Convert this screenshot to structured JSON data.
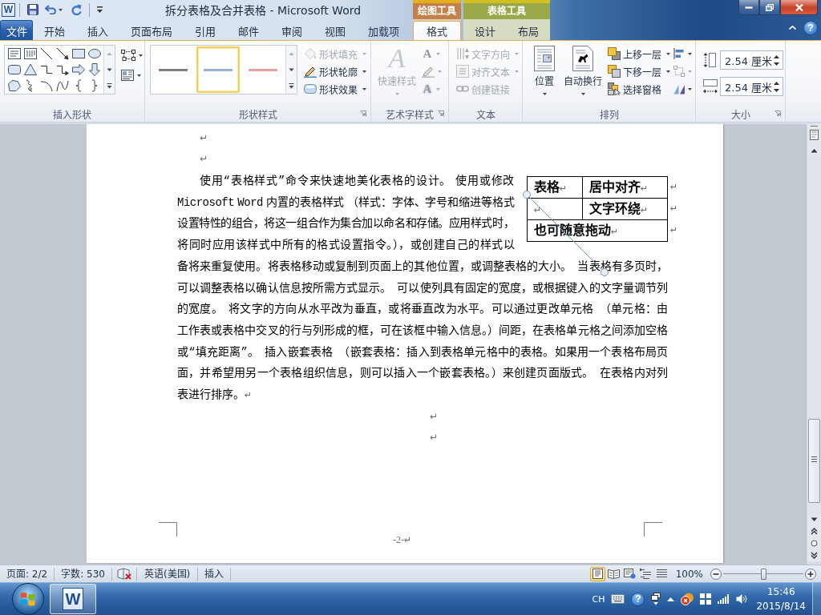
{
  "title_bar": {
    "app_letter": "W",
    "title": "拆分表格及合并表格 - Microsoft Word"
  },
  "file_tab": {
    "label": "文件"
  },
  "tabs": [
    {
      "label": "开始",
      "selected": false
    },
    {
      "label": "插入",
      "selected": false
    },
    {
      "label": "页面布局",
      "selected": false
    },
    {
      "label": "引用",
      "selected": false
    },
    {
      "label": "邮件",
      "selected": false
    },
    {
      "label": "审阅",
      "selected": false
    },
    {
      "label": "视图",
      "selected": false
    },
    {
      "label": "加载项",
      "selected": false
    }
  ],
  "context_groups": [
    {
      "label": "绘图工具",
      "color": "#c4824a",
      "tabs": [
        {
          "label": "格式",
          "selected": true
        }
      ]
    },
    {
      "label": "表格工具",
      "color": "#9aa84a",
      "tabs": [
        {
          "label": "设计",
          "selected": false
        },
        {
          "label": "布局",
          "selected": false
        }
      ]
    }
  ],
  "help": "?",
  "ribbon": {
    "groups": [
      {
        "kind": "shapes",
        "label": "插入形状",
        "launcher": false
      },
      {
        "kind": "shape_styles",
        "label": "形状样式",
        "launcher": true,
        "styles": [
          {
            "color": "#7f7f7f",
            "selected": false
          },
          {
            "color": "#95b3d7",
            "selected": true
          },
          {
            "color": "#e6a0a0",
            "selected": false
          }
        ],
        "commands": [
          {
            "label": "形状填充",
            "disabled": true
          },
          {
            "label": "形状轮廓",
            "disabled": false
          },
          {
            "label": "形状效果",
            "disabled": false
          }
        ]
      },
      {
        "kind": "wordart",
        "label": "艺术字样式",
        "launcher": true,
        "quick_styles": {
          "glyph": "A",
          "label": "快速样式",
          "disabled": true
        },
        "small_buttons": [
          {
            "glyph": "A",
            "disabled": true
          },
          {
            "disabled": true
          },
          {
            "glyph": "A",
            "disabled": true
          }
        ]
      },
      {
        "kind": "text",
        "label": "文本",
        "launcher": false,
        "commands": [
          {
            "label": "文字方向",
            "disabled": true,
            "dropdown": true
          },
          {
            "label": "对齐文本",
            "disabled": true,
            "dropdown": true
          },
          {
            "label": "创建链接",
            "disabled": true,
            "dropdown": false
          }
        ]
      },
      {
        "kind": "arrange",
        "label": "排列",
        "launcher": false,
        "large_buttons": [
          {
            "label": "位置"
          },
          {
            "label": "自动换行"
          }
        ],
        "commands": [
          {
            "label": "上移一层",
            "dropdown": true
          },
          {
            "label": "下移一层",
            "dropdown": true
          },
          {
            "label": "选择窗格",
            "dropdown": false
          }
        ],
        "icon_buttons": [
          {
            "disabled": false
          },
          {
            "disabled": true
          },
          {
            "disabled": false
          }
        ]
      },
      {
        "kind": "size",
        "label": "大小",
        "launcher": true,
        "fields": [
          {
            "value": "2.54 厘米"
          },
          {
            "value": "2.54 厘米"
          }
        ]
      }
    ]
  },
  "document": {
    "paragraphs_before": [
      {
        "mark": "↵"
      },
      {
        "mark": "↵"
      }
    ],
    "body": {
      "text_beside_table": "使用“表格样式”命令来快速地美化表格的设计。 使用或修改Microsoft Word 内置的表格样式 （样式：字体、字号和缩进等格式设置特性的组合，将这一组合作为集合加以命名和存储。应用样式时，将同时应用该样式中所有的格式设置指令。），或创建自己的样式以",
      "text": "备将来重复使用。将表格移动或复制到页面上的其他位置，或调整表格的大小。 当表格有多页时，可以调整表格以确认信息按所需方式显示。 可以使列具有固定的宽度，或根据键入的文字量调节列的宽度。  将文字的方向从水平改为垂直，或将垂直改为水平。可以通过更改单元格 （单元格：由工作表或表格中交叉的行与列形成的框，可在该框中输入信息。）间距，在表格单元格之间添加空格或“填充距离”。 插入嵌套表格 （嵌套表格：插入到表格单元格中的表格。如果用一个表格布局页面，并希望用另一个表格组织信息，则可以插入一个嵌套表格。）来创建页面版式。 在表格内对列表进行排序。",
      "mark": "↵"
    },
    "table": {
      "rows": [
        {
          "cells": [
            {
              "text": "表格",
              "mark": "↵"
            },
            {
              "text": "居中对齐",
              "mark": "↵"
            }
          ],
          "mark": "↵"
        },
        {
          "cells": [
            {
              "mark": "↵"
            },
            {
              "text": "文字环绕",
              "mark": "↵"
            }
          ],
          "mark": "↵"
        },
        {
          "cells": [
            {
              "text": "也可随意拖动",
              "mark": "↵",
              "colspan": 2
            }
          ],
          "mark": "↵"
        }
      ]
    },
    "line_shape": {
      "selected": true
    },
    "paragraphs_after": [
      {
        "mark": "↵"
      },
      {
        "mark": "↵"
      }
    ],
    "footer": {
      "page_number": "-2-",
      "mark": "↵"
    }
  },
  "status_bar": {
    "page": "页面: 2/2",
    "words": "字数: 530",
    "language": "英语(美国)",
    "mode": "插入",
    "views": [
      {
        "selected": true
      },
      {
        "selected": false
      },
      {
        "selected": false
      },
      {
        "selected": false
      },
      {
        "selected": false
      }
    ],
    "zoom": "100%",
    "zoom_slider": {
      "level": 0.5
    }
  },
  "taskbar": {
    "apps": [
      {
        "letter": "W",
        "selected": true
      }
    ],
    "tray": {
      "language": "CH",
      "help": "?",
      "time": "15:46",
      "date": "2015/8/14"
    }
  }
}
